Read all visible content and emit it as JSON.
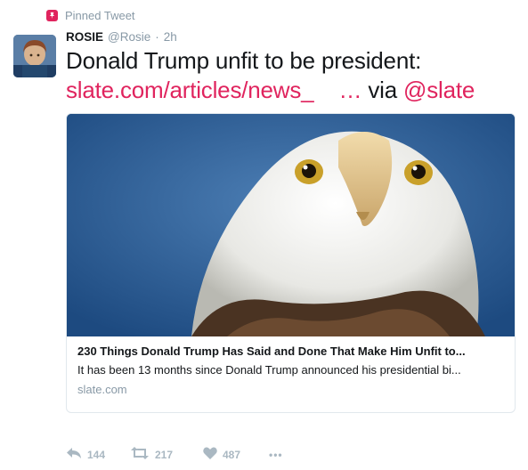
{
  "pinned": {
    "label": "Pinned Tweet",
    "icon": "pin-icon"
  },
  "author": {
    "name": "ROSIE",
    "handle": "@Rosie",
    "separator": "·",
    "time": "2h",
    "avatar_icon": "avatar"
  },
  "tweet": {
    "text": "Donald Trump unfit to be president:",
    "link_text": "slate.com/articles/news_",
    "ellipsis": "…",
    "via": " via ",
    "mention": "@slate"
  },
  "card": {
    "image_subject": "bald eagle",
    "title": "230 Things Donald Trump Has Said and Done That Make Him Unfit to...",
    "description": "It has been 13 months since Donald Trump announced his presidential bi...",
    "domain": "slate.com"
  },
  "actions": {
    "reply_count": "144",
    "retweet_count": "217",
    "like_count": "487",
    "more_label": "•••"
  },
  "colors": {
    "accent": "#e0245e",
    "muted": "#8899a6",
    "action_icons": "#aab8c2",
    "card_border": "#e1e8ed"
  }
}
